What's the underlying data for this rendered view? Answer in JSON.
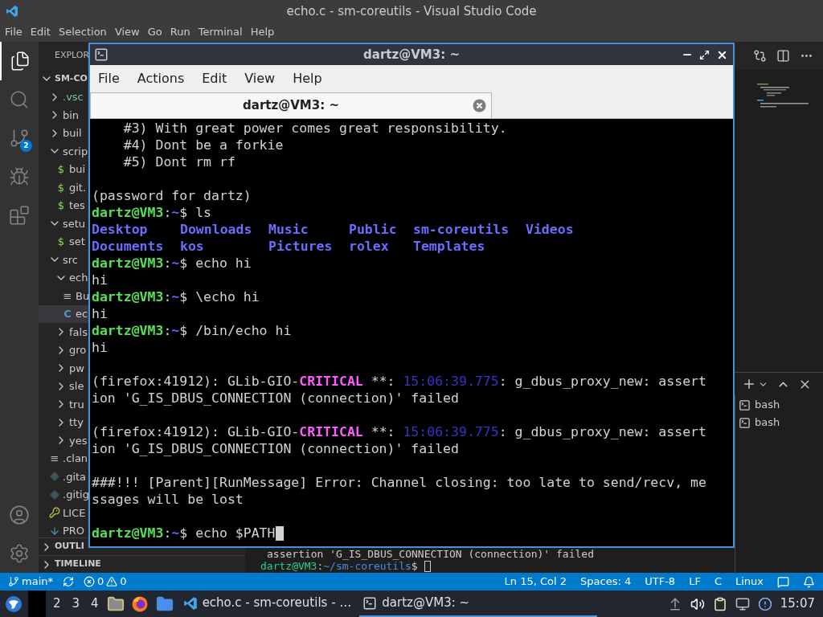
{
  "window": {
    "title": "echo.c - sm-coreutils - Visual Studio Code"
  },
  "menu": [
    "File",
    "Edit",
    "Selection",
    "View",
    "Go",
    "Run",
    "Terminal",
    "Help"
  ],
  "activity": {
    "scm_badge": "2"
  },
  "explorer": {
    "title": "EXPLOR",
    "root": "SM-CO",
    "items": [
      {
        "label": ".vsc",
        "kind": "folder",
        "expanded": false,
        "selected": false,
        "color": "#73c991"
      },
      {
        "label": "bin",
        "kind": "folder",
        "expanded": false,
        "selected": false
      },
      {
        "label": "buil",
        "kind": "folder",
        "expanded": false,
        "selected": false
      },
      {
        "label": "scrip",
        "kind": "folder",
        "expanded": true,
        "selected": false,
        "children": [
          {
            "label": "bui",
            "kind": "shell",
            "icon": "$",
            "selected": false
          },
          {
            "label": "git.",
            "kind": "shell",
            "icon": "$",
            "selected": false
          },
          {
            "label": "tes",
            "kind": "shell",
            "icon": "$",
            "selected": false
          }
        ]
      },
      {
        "label": "setu",
        "kind": "folder",
        "expanded": true,
        "selected": false,
        "children": [
          {
            "label": "set",
            "kind": "shell",
            "icon": "$",
            "selected": false
          }
        ]
      },
      {
        "label": "src",
        "kind": "folder",
        "expanded": true,
        "selected": false,
        "children": [
          {
            "label": "ech",
            "kind": "folder",
            "expanded": true,
            "selected": false,
            "children": [
              {
                "label": "Bu",
                "kind": "text",
                "icon": "≡",
                "selected": false
              },
              {
                "label": "ec",
                "kind": "c",
                "icon": "C",
                "selected": true
              }
            ]
          },
          {
            "label": "fals",
            "kind": "folder",
            "expanded": false,
            "selected": false
          },
          {
            "label": "gro",
            "kind": "folder",
            "expanded": false,
            "selected": false
          },
          {
            "label": "pw",
            "kind": "folder",
            "expanded": false,
            "selected": false
          },
          {
            "label": "sle",
            "kind": "folder",
            "expanded": false,
            "selected": false
          },
          {
            "label": "tru",
            "kind": "folder",
            "expanded": false,
            "selected": false
          },
          {
            "label": "tty",
            "kind": "folder",
            "expanded": false,
            "selected": false
          },
          {
            "label": "yes",
            "kind": "folder",
            "expanded": false,
            "selected": false
          }
        ]
      },
      {
        "label": ".clan",
        "kind": "text",
        "icon": "≡",
        "selected": false
      },
      {
        "label": ".gita",
        "kind": "git",
        "selected": false
      },
      {
        "label": ".gitig",
        "kind": "git",
        "selected": false
      },
      {
        "label": "LICE",
        "kind": "license",
        "selected": false
      },
      {
        "label": "PRO",
        "kind": "markdown",
        "selected": false
      }
    ],
    "sections": [
      "OUTLI",
      "TIMELINE"
    ]
  },
  "panel": {
    "lines": [
      {
        "segments": [
          {
            "text": "assertion 'G_IS_DBUS_CONNECTION (connection)' failed",
            "kind": "plain"
          }
        ]
      },
      {
        "segments": [
          {
            "text": "dartz@VM3",
            "kind": "user"
          },
          {
            "text": ":",
            "kind": "plain"
          },
          {
            "text": "~/sm-coreutils",
            "kind": "path"
          },
          {
            "text": "$",
            "kind": "plain"
          }
        ],
        "cursor": true
      }
    ],
    "terminals": [
      "bash",
      "bash"
    ]
  },
  "status": {
    "branch": "main*",
    "errors": "0",
    "warnings": "0",
    "right": [
      "Ln 15, Col 2",
      "Spaces: 4",
      "UTF-8",
      "LF",
      "C",
      "Linux"
    ]
  },
  "taskbar": {
    "workspaces": [
      "2",
      "3",
      "4"
    ],
    "tasks": [
      {
        "label": "echo.c - sm-coreutils - …",
        "kind": "vscode",
        "selected": false
      },
      {
        "label": "dartz@VM3: ~",
        "kind": "terminal",
        "selected": true
      }
    ],
    "clock": "15:07"
  },
  "terminal_window": {
    "title": "dartz@VM3: ~",
    "menu": [
      "File",
      "Actions",
      "Edit",
      "View",
      "Help"
    ],
    "tabs": [
      {
        "label": "dartz@VM3: ~",
        "selected": true
      }
    ],
    "lines": [
      {
        "segments": [
          {
            "text": "    #3) With great power comes great responsibility.",
            "kind": "plain"
          }
        ]
      },
      {
        "segments": [
          {
            "text": "    #4) Dont be a forkie",
            "kind": "plain"
          }
        ]
      },
      {
        "segments": [
          {
            "text": "    #5) Dont rm rf",
            "kind": "plain"
          }
        ]
      },
      {
        "kind": "blank"
      },
      {
        "segments": [
          {
            "text": "(password for dartz)",
            "kind": "plain"
          }
        ]
      },
      {
        "segments": [
          {
            "text": "dartz@VM3",
            "kind": "user"
          },
          {
            "text": ":",
            "kind": "plain"
          },
          {
            "text": "~",
            "kind": "path"
          },
          {
            "text": "$ ls",
            "kind": "plain"
          }
        ]
      },
      {
        "kind": "listing",
        "entries": [
          {
            "text": "Desktop",
            "kind": "dir"
          },
          {
            "text": "Downloads",
            "kind": "dir"
          },
          {
            "text": "Music",
            "kind": "dir"
          },
          {
            "text": "Public",
            "kind": "dir"
          },
          {
            "text": "sm-coreutils",
            "kind": "dir"
          },
          {
            "text": "Videos",
            "kind": "dir"
          }
        ]
      },
      {
        "kind": "listing",
        "entries": [
          {
            "text": "Documents",
            "kind": "dir"
          },
          {
            "text": "kos",
            "kind": "dir"
          },
          {
            "text": "Pictures",
            "kind": "dir"
          },
          {
            "text": "rolex",
            "kind": "dir"
          },
          {
            "text": "Templates",
            "kind": "dir"
          }
        ]
      },
      {
        "segments": [
          {
            "text": "dartz@VM3",
            "kind": "user"
          },
          {
            "text": ":",
            "kind": "plain"
          },
          {
            "text": "~",
            "kind": "path"
          },
          {
            "text": "$ echo hi",
            "kind": "plain"
          }
        ]
      },
      {
        "segments": [
          {
            "text": "hi",
            "kind": "plain"
          }
        ]
      },
      {
        "segments": [
          {
            "text": "dartz@VM3",
            "kind": "user"
          },
          {
            "text": ":",
            "kind": "plain"
          },
          {
            "text": "~",
            "kind": "path"
          },
          {
            "text": "$ \\echo hi",
            "kind": "plain"
          }
        ]
      },
      {
        "segments": [
          {
            "text": "hi",
            "kind": "plain"
          }
        ]
      },
      {
        "segments": [
          {
            "text": "dartz@VM3",
            "kind": "user"
          },
          {
            "text": ":",
            "kind": "plain"
          },
          {
            "text": "~",
            "kind": "path"
          },
          {
            "text": "$ /bin/echo hi",
            "kind": "plain"
          }
        ]
      },
      {
        "segments": [
          {
            "text": "hi",
            "kind": "plain"
          }
        ]
      },
      {
        "kind": "blank"
      },
      {
        "segments": [
          {
            "text": "(firefox:41912): GLib-GIO-",
            "kind": "plain"
          },
          {
            "text": "CRITICAL",
            "kind": "critical"
          },
          {
            "text": " **: ",
            "kind": "plain"
          },
          {
            "text": "15:06:39.775",
            "kind": "time"
          },
          {
            "text": ": g_dbus_proxy_new: assert",
            "kind": "plain"
          }
        ]
      },
      {
        "segments": [
          {
            "text": "ion 'G_IS_DBUS_CONNECTION (connection)' failed",
            "kind": "plain"
          }
        ]
      },
      {
        "kind": "blank"
      },
      {
        "segments": [
          {
            "text": "(firefox:41912): GLib-GIO-",
            "kind": "plain"
          },
          {
            "text": "CRITICAL",
            "kind": "critical"
          },
          {
            "text": " **: ",
            "kind": "plain"
          },
          {
            "text": "15:06:39.775",
            "kind": "time"
          },
          {
            "text": ": g_dbus_proxy_new: assert",
            "kind": "plain"
          }
        ]
      },
      {
        "segments": [
          {
            "text": "ion 'G_IS_DBUS_CONNECTION (connection)' failed",
            "kind": "plain"
          }
        ]
      },
      {
        "kind": "blank"
      },
      {
        "segments": [
          {
            "text": "###!!! [Parent][RunMessage] Error: Channel closing: too late to send/recv, me",
            "kind": "plain"
          }
        ]
      },
      {
        "segments": [
          {
            "text": "ssages will be lost",
            "kind": "plain"
          }
        ]
      },
      {
        "kind": "blank"
      },
      {
        "segments": [
          {
            "text": "dartz@VM3",
            "kind": "user"
          },
          {
            "text": ":",
            "kind": "plain"
          },
          {
            "text": "~",
            "kind": "path"
          },
          {
            "text": "$ echo $PATH",
            "kind": "plain"
          }
        ],
        "cursor": true
      }
    ]
  }
}
